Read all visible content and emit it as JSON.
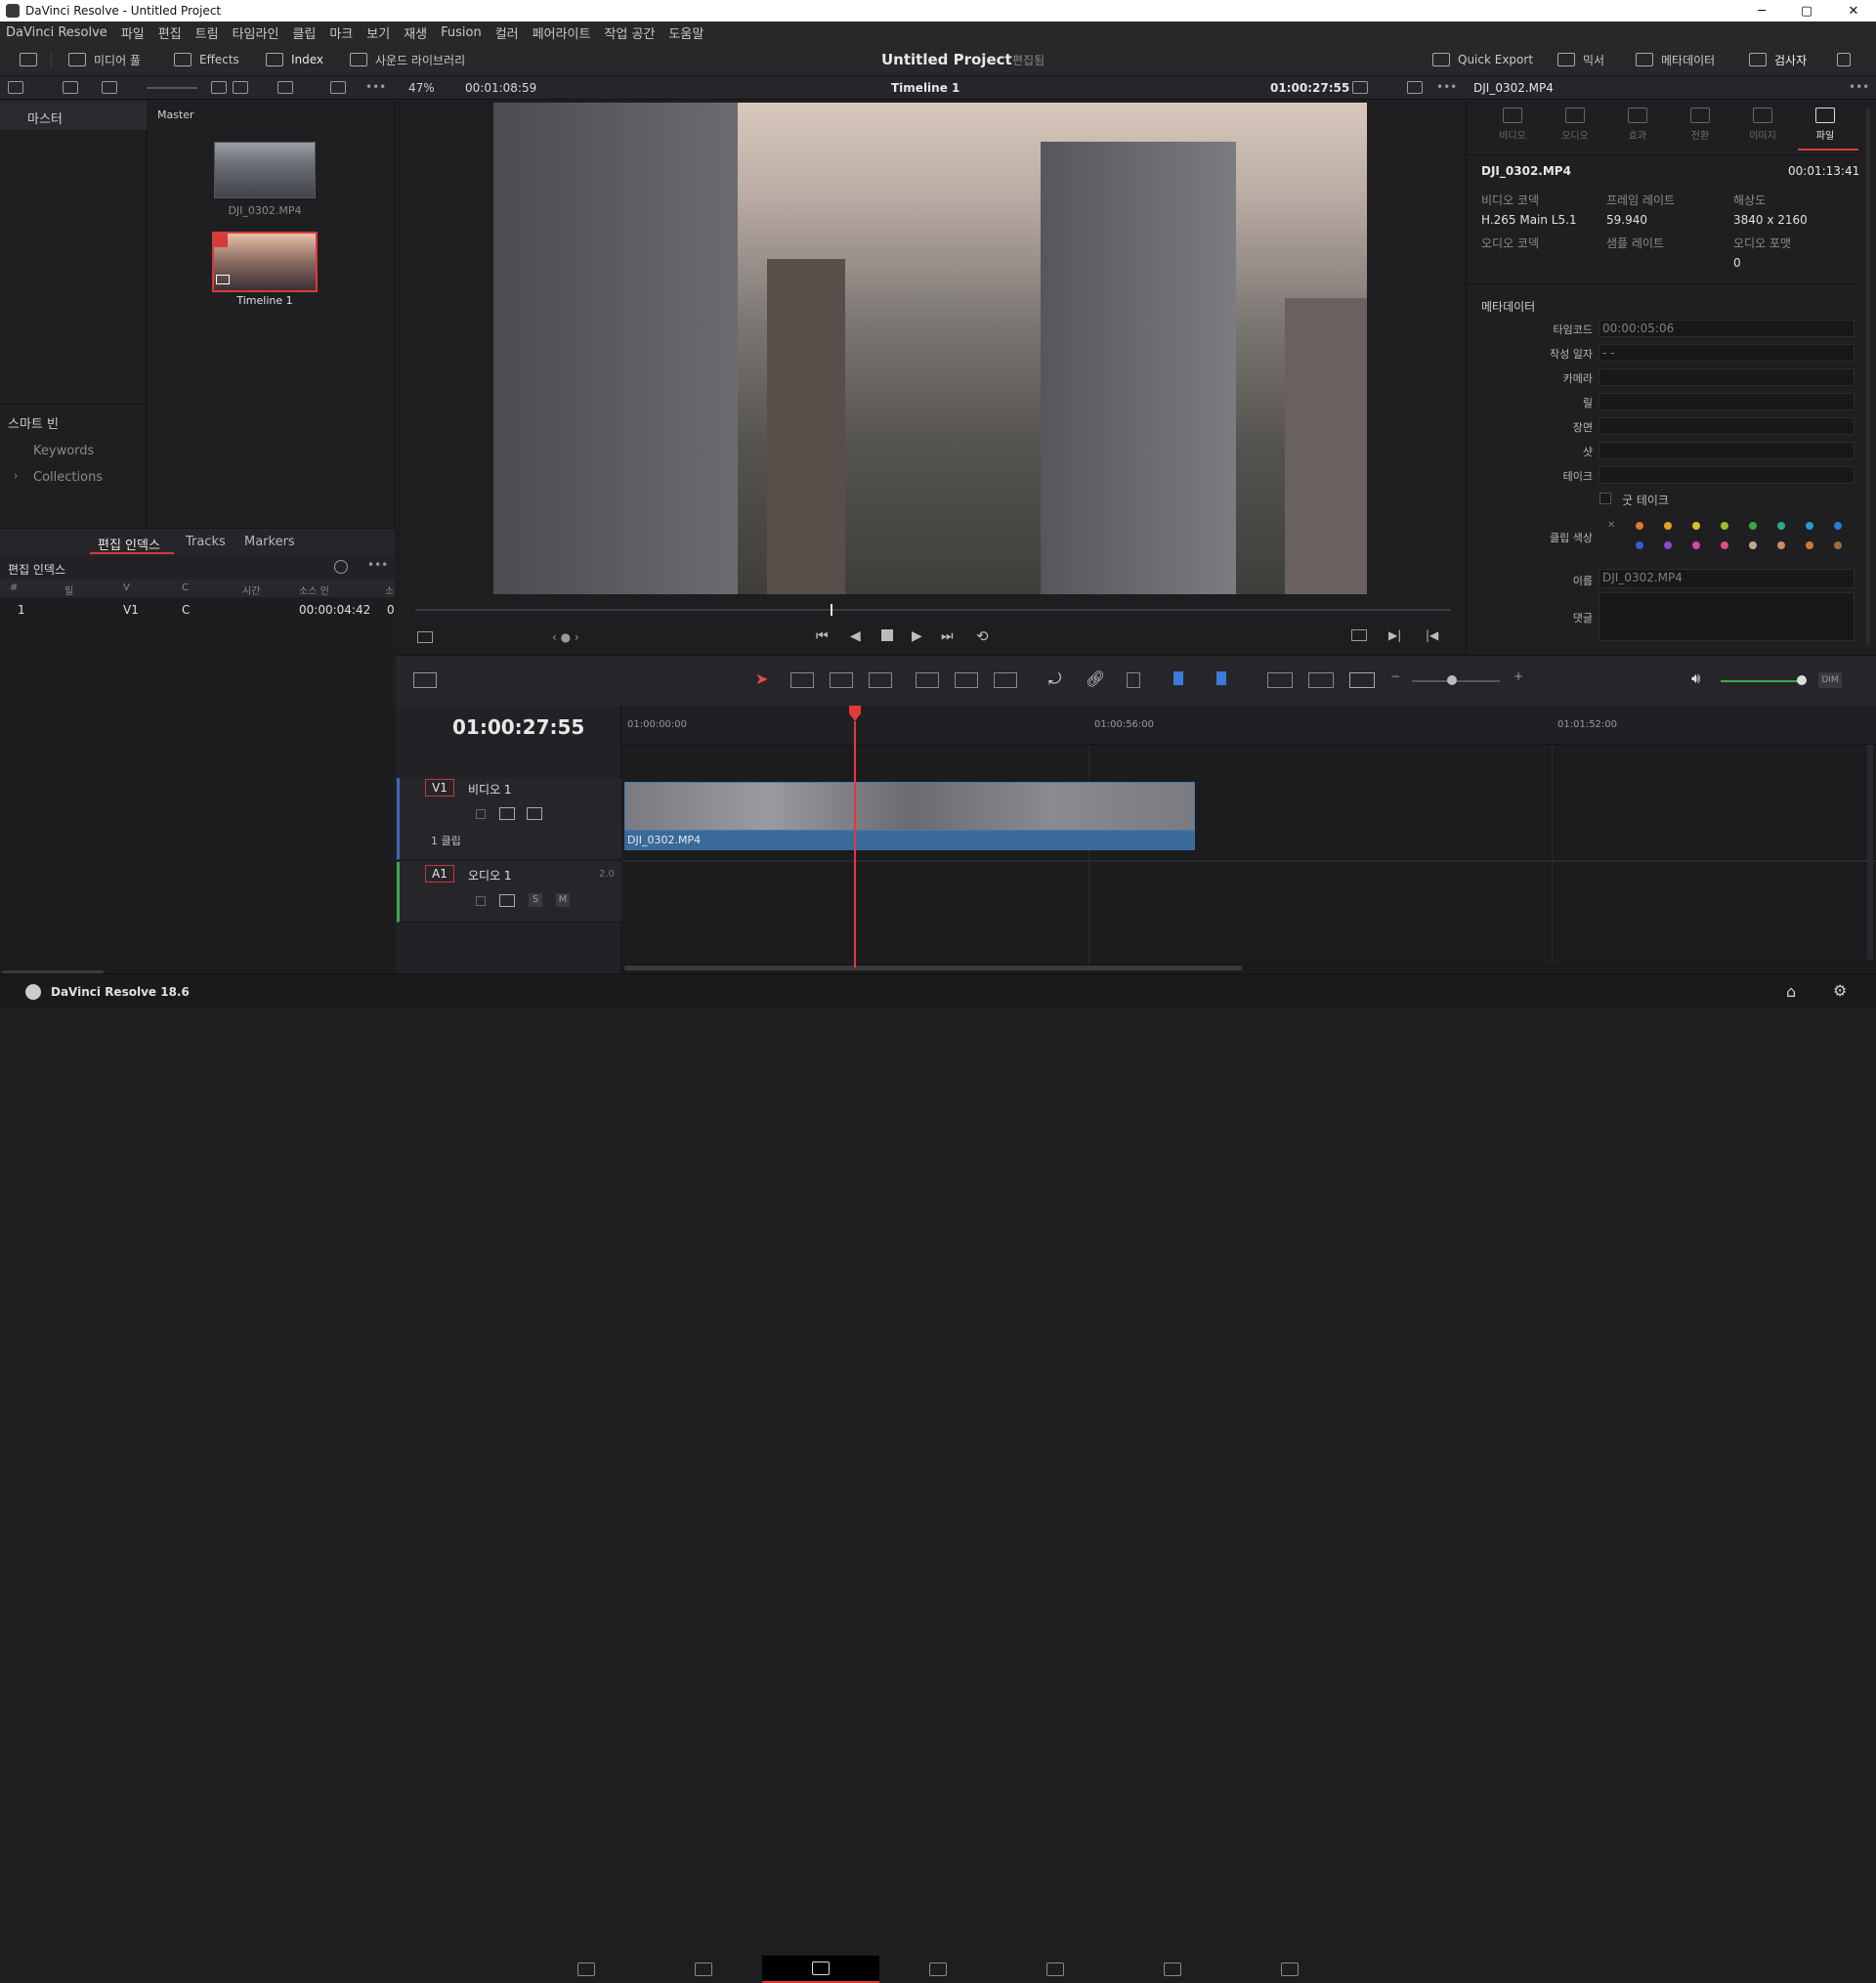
{
  "window": {
    "title": "DaVinci Resolve - Untitled Project",
    "minimize": "─",
    "maximize": "▢",
    "close": "✕"
  },
  "menu": [
    "DaVinci Resolve",
    "파일",
    "편집",
    "트림",
    "타임라인",
    "클립",
    "마크",
    "보기",
    "재생",
    "Fusion",
    "컬러",
    "페어라이트",
    "작업 공간",
    "도움말"
  ],
  "toolbar": {
    "media_pool": "미디어 풀",
    "effects": "Effects",
    "index": "Index",
    "sound_library": "사운드 라이브러리",
    "project_title": "Untitled Project",
    "edit_state": "편집됨",
    "quick_export": "Quick Export",
    "mixer": "믹서",
    "metadata": "메타데이터",
    "inspector": "검사자"
  },
  "viewer": {
    "zoom": "47%",
    "duration": "00:01:08:59",
    "timeline_name": "Timeline 1",
    "timecode": "01:00:27:55"
  },
  "media_pool": {
    "master_label": "마스터",
    "bin_header": "Master",
    "clips": [
      {
        "name": "DJI_0302.MP4"
      },
      {
        "name": "Timeline 1"
      }
    ],
    "smart_bin": "스마트 빈",
    "smart_items": [
      "Keywords",
      "Collections"
    ]
  },
  "edit_index": {
    "tabs": [
      "편집 인덱스",
      "Tracks",
      "Markers"
    ],
    "title": "편집 인덱스",
    "columns": [
      "#",
      "릴",
      "V",
      "C",
      "시간",
      "소스 인",
      "소"
    ],
    "rows": [
      {
        "num": "1",
        "v": "V1",
        "c": "C",
        "src_in": "00:00:04:42",
        "extra": "0"
      }
    ]
  },
  "inspector": {
    "clip_name": "DJI_0302.MP4",
    "tabs": [
      "비디오",
      "오디오",
      "효과",
      "전환",
      "이미지",
      "파일"
    ],
    "file_name": "DJI_0302.MP4",
    "file_duration": "00:01:13:41",
    "video_codec_label": "비디오 코덱",
    "video_codec": "H.265 Main L5.1",
    "frame_rate_label": "프레임 레이트",
    "frame_rate": "59.940",
    "resolution_label": "해상도",
    "resolution": "3840 x 2160",
    "audio_codec_label": "오디오 코덱",
    "sample_rate_label": "샘플 레이트",
    "audio_format_label": "오디오 포맷",
    "audio_format": "0",
    "metadata_header": "메타데이터",
    "fields": [
      {
        "label": "타임코드",
        "value": "00:00:05:06"
      },
      {
        "label": "작성 일자",
        "value": " -  - "
      },
      {
        "label": "카메라",
        "value": ""
      },
      {
        "label": "릴",
        "value": ""
      },
      {
        "label": "장면",
        "value": ""
      },
      {
        "label": "샷",
        "value": ""
      },
      {
        "label": "테이크",
        "value": ""
      }
    ],
    "good_take": "굿 테이크",
    "clip_color_label": "클립 색상",
    "name_label": "이름",
    "name_value": "DJI_0302.MP4",
    "comments_label": "댓글",
    "colors": [
      "#e07a2a",
      "#e0a22a",
      "#d4c22a",
      "#9ac22a",
      "#3aa83a",
      "#2aa88a",
      "#2a9ad0",
      "#2a7ad0",
      "#3a5ad0",
      "#8a4ad0",
      "#d04aa8",
      "#e04a8a",
      "#c0a890",
      "#c89060",
      "#d07a30",
      "#a06a3a"
    ]
  },
  "timeline": {
    "timecode": "01:00:27:55",
    "ruler": [
      "01:00:00:00",
      "01:00:56:00",
      "01:01:52:00"
    ],
    "v1_tag": "V1",
    "v1_name": "비디오 1",
    "v1_clips": "1 클립",
    "a1_tag": "A1",
    "a1_name": "오디오 1",
    "a1_channels": "2.0",
    "clip_label": "DJI_0302.MP4",
    "solo": "S",
    "mute": "M",
    "dim": "DIM",
    "playhead_fraction": 0.25
  },
  "footer": {
    "app_version": "DaVinci Resolve 18.6"
  }
}
